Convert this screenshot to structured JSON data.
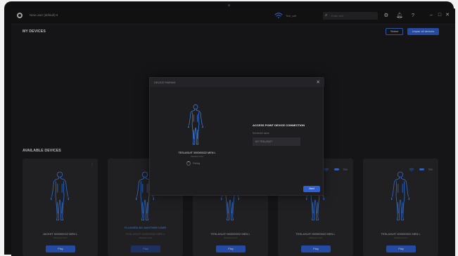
{
  "header": {
    "user_menu": "New user (default) ▾",
    "wifi_label": "Tesl_wifi",
    "search_placeholder": "Enter text",
    "settings_icon": "gear-icon",
    "notifications_icon": "bell-icon",
    "help_icon": "question-icon",
    "window_minimize": "–",
    "window_maximize": "□",
    "window_close": "✕"
  },
  "my_devices": {
    "title": "MY DEVICES",
    "select_label": "Select",
    "unpair_all_label": "Unpair all devices"
  },
  "available_devices": {
    "title": "AVAILABLE DEVICES",
    "cards": [
      {
        "name": "JACKET 000000022 MEN L",
        "sub": "Wireless Cord",
        "action": "Play",
        "menu": "⋮"
      },
      {
        "name": "TESLASUIT 000000022 MEN L",
        "sub": "Wireless Cord",
        "action": "Play",
        "warning": "PLUGGED BY ANOTHER USER"
      },
      {
        "name": "TESLASUIT 000000022 MEN L",
        "sub": "Wireless Cord",
        "action": "Play"
      },
      {
        "name": "TESLASUIT 000000022 MEN L",
        "sub": "Wireless Cord",
        "action": "Play",
        "battery": "70%"
      },
      {
        "name": "TESLASUIT 000000022 MEN L",
        "sub": "Wireless Cord",
        "action": "Play",
        "battery": "70%"
      }
    ]
  },
  "modal": {
    "title": "DEVICE PAIRING",
    "close": "✕",
    "device_name": "TESLASUIT 000000022 MEN L",
    "device_sub": "Wireless Cord",
    "status": "Pairing",
    "ap_title": "ACCESS POINT DEVICE CONNECTION",
    "ap_label": "Set device name",
    "ap_placeholder": "MY TESLASUIT",
    "next_label": "Next"
  },
  "colors": {
    "accent": "#2f5fd0",
    "figure": "#3a86ff",
    "background": "#1c1c1e",
    "card": "#29292c"
  }
}
